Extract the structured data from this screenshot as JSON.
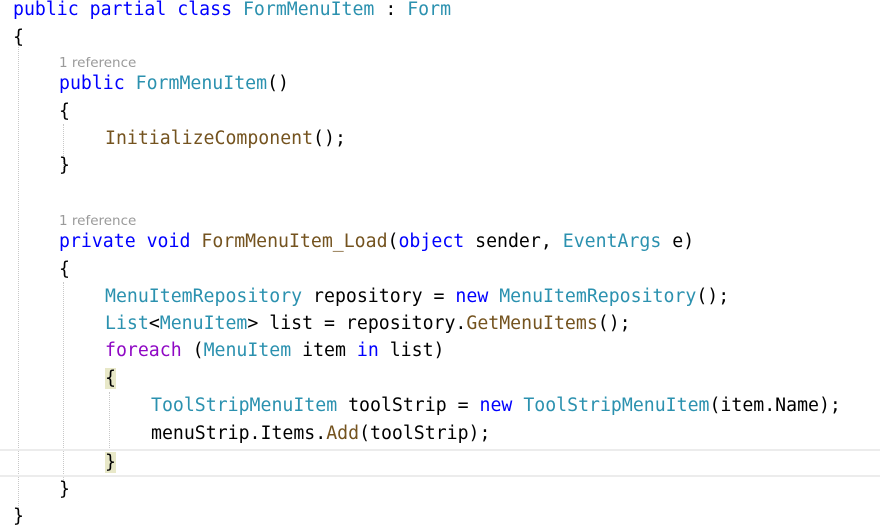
{
  "codelens": {
    "constructor_refs": "1 reference",
    "load_refs": "1 reference"
  },
  "code": {
    "l1": {
      "public": "public",
      "partial": "partial",
      "class": "class",
      "name": "FormMenuItem",
      "colon": " : ",
      "base": "Form"
    },
    "l2": {
      "brace": "{"
    },
    "l3": {
      "public": "public",
      "name": "FormMenuItem",
      "parens": "()"
    },
    "l4": {
      "brace": "{"
    },
    "l5": {
      "call": "InitializeComponent",
      "rest": "();"
    },
    "l6": {
      "brace": "}"
    },
    "l7": {
      "private": "private",
      "void": "void",
      "name": "FormMenuItem_Load",
      "open": "(",
      "object": "object",
      "sender": " sender, ",
      "argtype": "EventArgs",
      "tail": " e)"
    },
    "l8": {
      "brace": "{"
    },
    "l9": {
      "type": "MenuItemRepository",
      "mid": " repository = ",
      "new": "new",
      "ctor": "MenuItemRepository",
      "rest": "();"
    },
    "l10": {
      "list": "List",
      "lt": "<",
      "arg": "MenuItem",
      "mid": "> list = repository.",
      "method": "GetMenuItems",
      "rest": "();"
    },
    "l11": {
      "foreach": "foreach",
      "open": " (",
      "type": "MenuItem",
      "item": " item ",
      "in": "in",
      "rest": " list)"
    },
    "l12": {
      "brace": "{"
    },
    "l13": {
      "type": "ToolStripMenuItem",
      "mid": " toolStrip = ",
      "new": "new",
      "ctor": "ToolStripMenuItem",
      "rest": "(item.Name);"
    },
    "l14": {
      "pre": "menuStrip.Items.",
      "method": "Add",
      "rest": "(toolStrip);"
    },
    "l15": {
      "brace": "}"
    },
    "l16": {
      "brace": "}"
    },
    "l17": {
      "brace": "}"
    }
  },
  "colors": {
    "keyword": "#0000ff",
    "type": "#2b91af",
    "method": "#74531f",
    "control": "#8f08c4",
    "codelens": "#9a9a9a"
  }
}
